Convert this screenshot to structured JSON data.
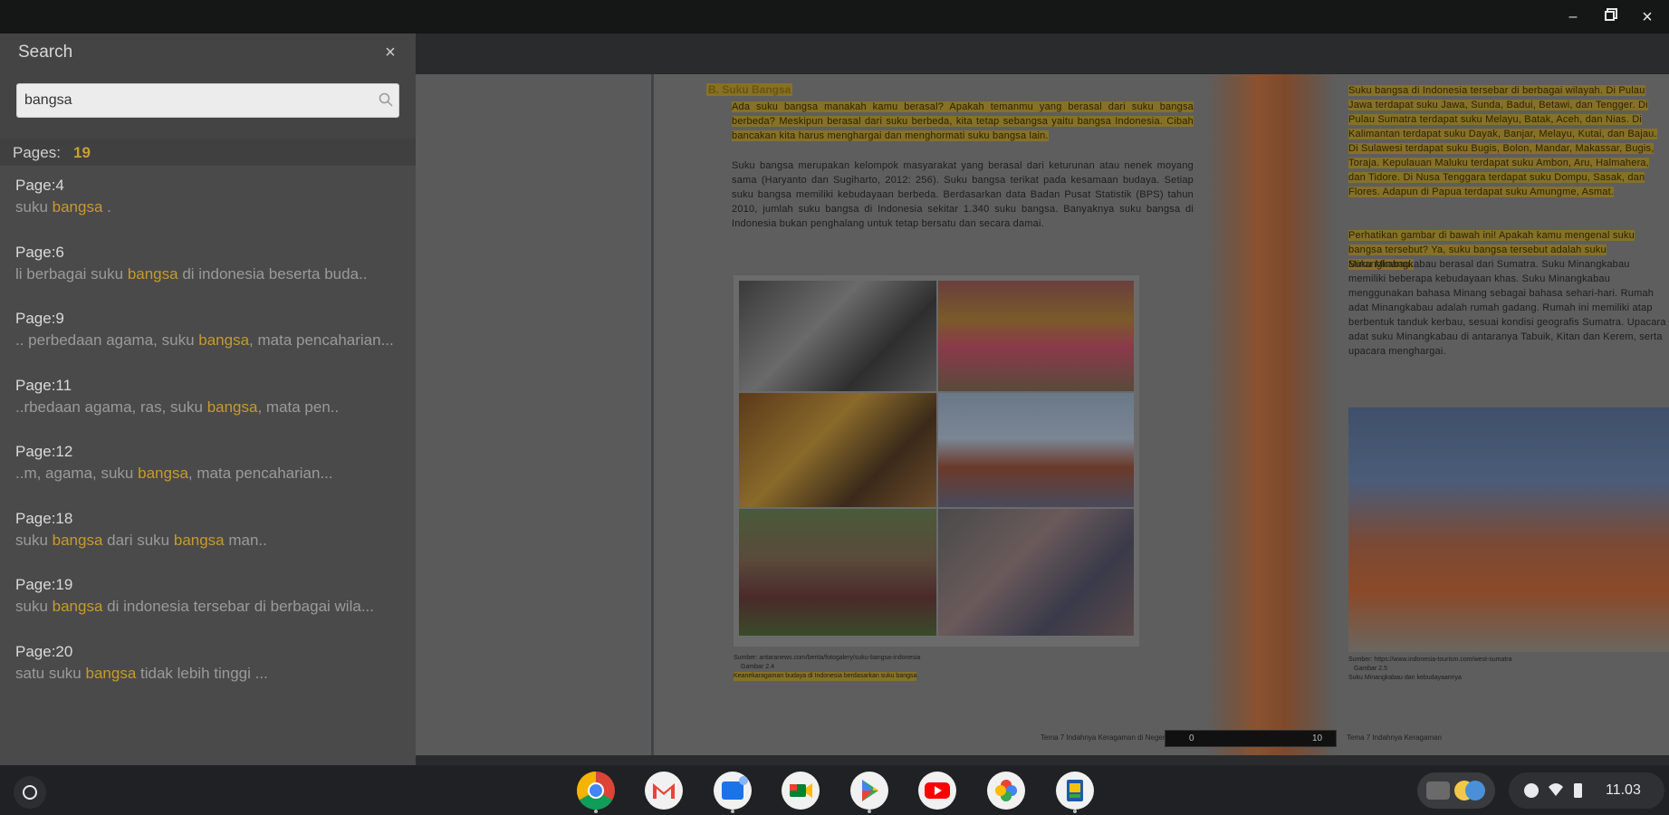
{
  "search": {
    "title": "Search",
    "query": "bangsa",
    "pages_label": "Pages:",
    "pages_count": "19",
    "results": [
      {
        "page": "Page:4",
        "pre": "suku ",
        "kw": "bangsa",
        "post": " ."
      },
      {
        "page": "Page:6",
        "pre": "li berbagai suku ",
        "kw": "bangsa",
        "post": " di indonesia beserta buda.."
      },
      {
        "page": "Page:9",
        "pre": ".. perbedaan agama, suku ",
        "kw": "bangsa",
        "post": ", mata pencaharian..."
      },
      {
        "page": "Page:11",
        "pre": "..rbedaan agama, ras, suku ",
        "kw": "bangsa",
        "post": ", mata pen.."
      },
      {
        "page": "Page:12",
        "pre": "..m, agama, suku ",
        "kw": "bangsa",
        "post": ", mata pencaharian..."
      },
      {
        "page": "Page:18",
        "pre": "suku ",
        "kw": "bangsa",
        "mid": " dari suku ",
        "kw2": "bangsa",
        "post": " man.."
      },
      {
        "page": "Page:19",
        "pre": "suku ",
        "kw": "bangsa",
        "post": " di indonesia tersebar di berbagai wila..."
      },
      {
        "page": "Page:20",
        "pre": "satu suku ",
        "kw": "bangsa",
        "post": " tidak lebih tinggi ..."
      }
    ]
  },
  "book": {
    "left_heading": "B.  Suku Bangsa",
    "left_paragraphs": [
      "Ada suku bangsa manakah kamu berasal? Apakah temanmu yang berasal dari suku bangsa berbeda? Meskipun berasal dari suku berbeda, kita tetap sebangsa yaitu bangsa Indonesia. Cibah bancakan kita harus menghargai dan menghormati suku bangsa lain.",
      "Suku bangsa merupakan kelompok masyarakat yang berasal dari keturunan atau nenek moyang sama (Haryanto dan Sugiharto, 2012: 256). Suku bangsa terikat pada kesamaan budaya. Setiap suku bangsa memiliki kebudayaan berbeda. Berdasarkan data Badan Pusat Statistik (BPS) tahun 2010, jumlah suku bangsa di Indonesia sekitar 1.340 suku bangsa. Banyaknya suku bangsa di Indonesia bukan penghalang untuk tetap bersatu dan secara damai."
    ],
    "left_caption_source": "Sumber: antaranews.com/berita/fotogalery/suku-bangsa-indonesia",
    "left_caption_label": "Gambar 2.4",
    "left_caption_text": "Keanekaragaman budaya di Indonesia berdasarkan suku bangsa",
    "right_paragraphs": [
      "Suku bangsa di Indonesia tersebar di berbagai wilayah. Di Pulau Jawa terdapat suku Jawa, Sunda, Badui, Betawi, dan Tengger. Di Pulau Sumatra terdapat suku Melayu, Batak, Aceh, dan Nias. Di Kalimantan terdapat suku Dayak, Banjar, Melayu, Kutai, dan Bajau. Di Sulawesi terdapat suku Bugis, Bolon, Mandar, Makassar, Bugis, Toraja. Kepulauan Maluku terdapat suku Ambon, Aru, Halmahera, dan Tidore. Di Nusa Tenggara terdapat suku Dompu, Sasak, dan Flores. Adapun di Papua terdapat suku Amungme, Asmat.",
      "Perhatikan gambar di bawah ini! Apakah kamu mengenal suku bangsa tersebut? Ya, suku bangsa tersebut adalah suku Minangkabau.",
      "Suku Minangkabau berasal dari Sumatra. Suku Minangkabau memiliki beberapa kebudayaan khas. Suku Minangkabau menggunakan bahasa Minang sebagai bahasa sehari-hari. Rumah adat Minangkabau adalah rumah gadang. Rumah ini memiliki atap berbentuk tanduk kerbau, sesuai kondisi geografis Sumatra. Upacara adat suku Minangkabau di antaranya Tabuik, Kitan dan Kerem, serta upacara menghargai."
    ],
    "right_caption_source": "Sumber: https://www.indonesia-tourism.com/west-sumatra",
    "right_caption_label": "Gambar 2.5",
    "right_caption_text": "Suku Minangkabau dan kebudayaannya",
    "footer_left": "Tema 7 Indahnya Keragaman di Negeriku",
    "footer_right": "Tema 7 Indahnya Keragaman",
    "pager_start": "0",
    "pager_end": "10"
  },
  "shelf": {
    "time": "11.03",
    "apps": [
      "Chrome",
      "Gmail",
      "Files",
      "Google Meet",
      "Play Store",
      "YouTube",
      "Google Photos",
      "Buku Reader"
    ]
  },
  "colors": {
    "keyword": "#c89a2a",
    "highlight": "#967814"
  }
}
